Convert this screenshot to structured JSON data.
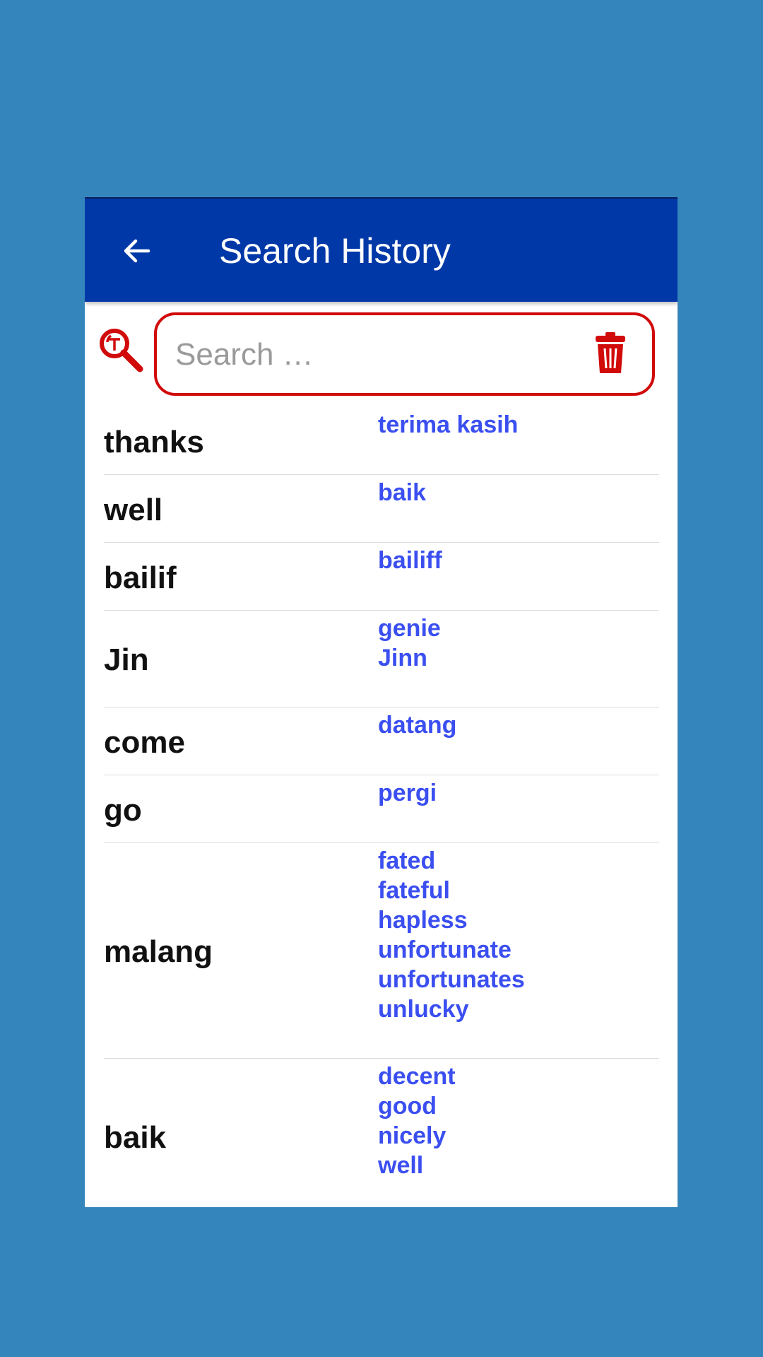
{
  "header": {
    "title": "Search History",
    "back_icon": "arrow-left-icon"
  },
  "search": {
    "placeholder": "Search …",
    "icon": "translate-search-icon",
    "clear_icon": "trash-icon"
  },
  "colors": {
    "background": "#3485bb",
    "header": "#0038a8",
    "accent_red": "#d10a0a",
    "translation_blue": "#3b4ff0"
  },
  "history": [
    {
      "word": "thanks",
      "translations": [
        "terima kasih"
      ]
    },
    {
      "word": "well",
      "translations": [
        "baik"
      ]
    },
    {
      "word": "bailif",
      "translations": [
        "bailiff"
      ]
    },
    {
      "word": "Jin",
      "translations": [
        "genie",
        "Jinn"
      ]
    },
    {
      "word": "come",
      "translations": [
        "datang"
      ]
    },
    {
      "word": "go",
      "translations": [
        "pergi"
      ]
    },
    {
      "word": "malang",
      "translations": [
        "fated",
        "fateful",
        "hapless",
        "unfortunate",
        "unfortunates",
        "unlucky"
      ]
    },
    {
      "word": "baik",
      "translations": [
        "decent",
        "good",
        "nicely",
        "well"
      ]
    }
  ]
}
